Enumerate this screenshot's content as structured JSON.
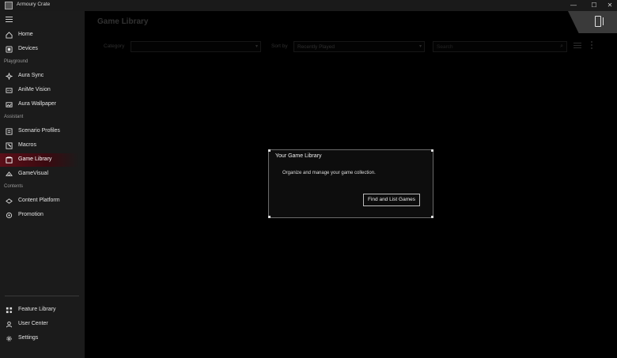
{
  "window": {
    "title": "Armoury Crate"
  },
  "sidebar": {
    "items": [
      {
        "label": "Home",
        "icon": "home-icon"
      },
      {
        "label": "Devices",
        "icon": "devices-icon"
      },
      {
        "label": "Aura Sync",
        "icon": "aura-sync-icon"
      },
      {
        "label": "AniMe Vision",
        "icon": "anime-vision-icon"
      },
      {
        "label": "Aura Wallpaper",
        "icon": "wallpaper-icon"
      },
      {
        "label": "Scenario Profiles",
        "icon": "scenario-icon"
      },
      {
        "label": "Macros",
        "icon": "macros-icon"
      },
      {
        "label": "Game Library",
        "icon": "game-library-icon"
      },
      {
        "label": "GameVisual",
        "icon": "gamevisual-icon"
      },
      {
        "label": "Content Platform",
        "icon": "content-platform-icon"
      },
      {
        "label": "Promotion",
        "icon": "promotion-icon"
      },
      {
        "label": "Feature Library",
        "icon": "feature-library-icon"
      },
      {
        "label": "User Center",
        "icon": "user-center-icon"
      },
      {
        "label": "Settings",
        "icon": "settings-icon"
      }
    ],
    "sections": {
      "playground": "Playground",
      "assistant": "Assistant",
      "contents": "Contents"
    },
    "active": "Game Library"
  },
  "main": {
    "title": "Game Library",
    "category_label": "Category",
    "category_value": "",
    "sort_label": "Sort by",
    "sort_value": "Recently Played",
    "search_placeholder": "Search"
  },
  "dialog": {
    "title": "Your Game Library",
    "message": "Organize and manage your game collection.",
    "button": "Find and List Games"
  },
  "colors": {
    "accent": "#5a0f18",
    "background": "#000000",
    "sidebar": "#1b1b1b"
  }
}
